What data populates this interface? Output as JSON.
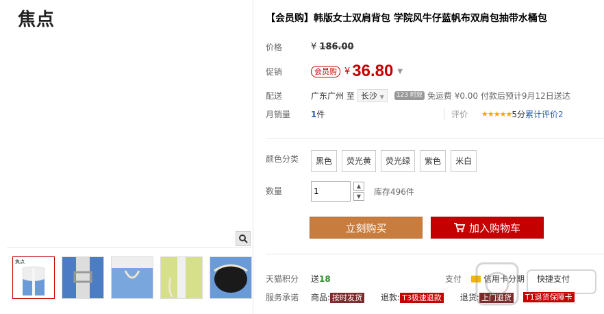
{
  "gallery": {
    "brand": "焦点",
    "thumb_brand": "焦点",
    "thumbs": [
      "thumb-1",
      "thumb-2",
      "thumb-3",
      "thumb-4",
      "thumb-5"
    ]
  },
  "product": {
    "title": "【会员购】韩版女士双肩背包 学院风牛仔蓝帆布双肩包抽带水桶包",
    "price_label": "价格",
    "original_price": "¥186.00",
    "original_currency": "¥",
    "original_value": "186.00",
    "promo_label": "促销",
    "promo_tag": "会员购",
    "currency": "¥",
    "promo_price": "36.80",
    "delivery_label": "配送",
    "delivery_from": "广东广州 至",
    "delivery_to": "长沙",
    "fast_badge": "123 时效",
    "shipping": "免运费 ¥0.00 付款后预计9月12日送达",
    "sales_label": "月销量",
    "sales_value": "1",
    "sales_unit": "件",
    "rating_label": "评价",
    "rating_score": "5分",
    "rating_text": "累计评价2",
    "color_label": "颜色分类",
    "colors": [
      "黑色",
      "荧光黄",
      "荧光绿",
      "紫色",
      "米白"
    ],
    "qty_label": "数量",
    "qty_value": "1",
    "stock": "库存496件",
    "buy_now": "立刻购买",
    "add_cart": "加入购物车",
    "points_label": "天猫积分",
    "points_prefix": "送",
    "points_value": "18",
    "pay_label": "支付",
    "pay_credit": "信用卡分期",
    "pay_fast": "快捷支付",
    "service_label": "服务承诺",
    "service": [
      {
        "prefix": "商品:",
        "tag": "按时发货"
      },
      {
        "prefix": "退款:",
        "tag": "T3极速退款"
      },
      {
        "prefix": "退货:",
        "tag": "上门退货"
      },
      {
        "prefix": "",
        "tag": "T1退货保障卡"
      }
    ]
  },
  "colors": {
    "accent_red": "#c40000",
    "buy_orange": "#c87c3e",
    "denim_blue": "#5b8fd0"
  }
}
